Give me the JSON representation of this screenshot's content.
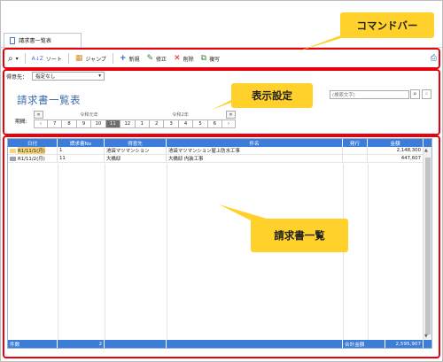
{
  "tab": {
    "label": "請求書一覧表"
  },
  "toolbar": {
    "items": [
      {
        "label": "",
        "icon": "search-icon"
      },
      {
        "label": "ソート",
        "icon": "sort-icon"
      },
      {
        "label": "ジャンプ",
        "icon": "calendar-icon"
      },
      {
        "label": "新規",
        "icon": "plus-icon"
      },
      {
        "label": "修正",
        "icon": "pencil-icon"
      },
      {
        "label": "削除",
        "icon": "x-icon"
      },
      {
        "label": "複写",
        "icon": "copy-icon"
      }
    ]
  },
  "filter": {
    "customer_label": "得意先：",
    "customer_value": "指定なし"
  },
  "page_title": "請求書一覧表",
  "period": {
    "label": "期間:",
    "year_prev": "令和元年",
    "year_next": "令和2年",
    "months": [
      "7",
      "8",
      "9",
      "10",
      "11",
      "12",
      "1",
      "2",
      "3",
      "4",
      "5",
      "6"
    ],
    "selected": "11"
  },
  "search": {
    "placeholder": "(検索文字)"
  },
  "table": {
    "headers": [
      "日付",
      "請求書No",
      "得意先",
      "件名",
      "発行",
      "金額"
    ],
    "rows": [
      {
        "date": "R1/11/1(月)",
        "no": "1",
        "customer": "池袋マツマンション",
        "subject": "池袋マツマンション屋上防水工事",
        "issued": "",
        "amount": "2,148,300"
      },
      {
        "date": "R1/11/2(月)",
        "no": "11",
        "customer": "大橋邸",
        "subject": "大橋邸 内装工事",
        "issued": "",
        "amount": "447,607"
      }
    ],
    "footer": {
      "count_label": "件数",
      "count": "2",
      "total_label": "合計金額",
      "total": "2,595,907"
    }
  },
  "annotations": {
    "command_bar": "コマンドバー",
    "display_settings": "表示設定",
    "invoice_list": "請求書一覧"
  },
  "colors": {
    "accent": "#3b7dd8",
    "annotation_frame": "#e8000b",
    "callout": "#ffd12a"
  }
}
